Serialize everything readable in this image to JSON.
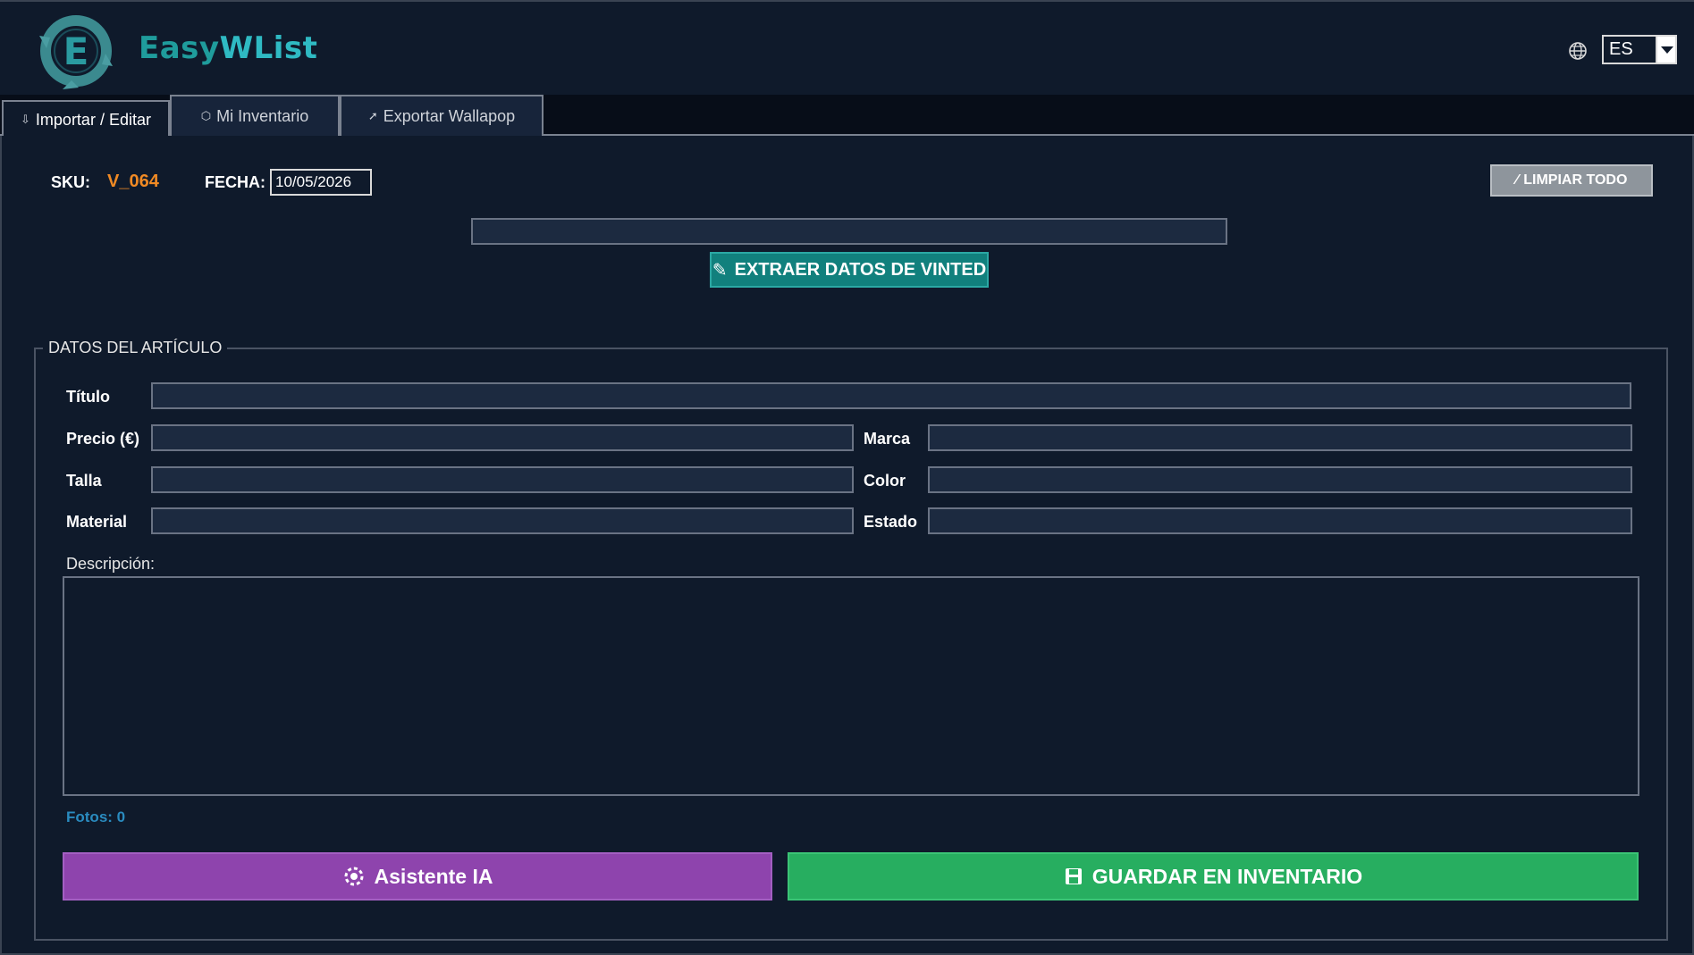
{
  "app": {
    "name_part1": "Easy",
    "name_part2": "WList",
    "logo_icon": "recycle-e-logo-icon",
    "brand_colors": {
      "teal": "#1f9c9c",
      "teal_light": "#2fbac3",
      "background": "#0f1a2b"
    }
  },
  "language": {
    "icon": "globe-icon",
    "selected": "ES"
  },
  "tabs": [
    {
      "label": "Importar / Editar",
      "icon": "import-icon",
      "active": true
    },
    {
      "label": "Mi Inventario",
      "icon": "box-icon",
      "active": false
    },
    {
      "label": "Exportar Wallapop",
      "icon": "rocket-icon",
      "active": false
    }
  ],
  "top": {
    "sku_label": "SKU:",
    "sku_value": "V_064",
    "date_label": "FECHA:",
    "date_value": "10/05/2026",
    "clear_label": "LIMPIAR TODO",
    "url_value": "",
    "extract_label": "EXTRAER DATOS DE VINTED"
  },
  "item": {
    "group_title": "DATOS DEL ARTÍCULO",
    "fields": {
      "title_label": "Título",
      "price_label": "Precio (€)",
      "brand_label": "Marca",
      "size_label": "Talla",
      "color_label": "Color",
      "material_label": "Material",
      "state_label": "Estado"
    },
    "description_label": "Descripción:",
    "photos_text": "Fotos: 0",
    "ai_label": "Asistente IA",
    "save_label": "GUARDAR EN INVENTARIO"
  },
  "colors": {
    "ai_button": "#8e44ad",
    "save_button": "#27ae60",
    "extract_button": "#11807d",
    "sku_value": "#f08a24"
  }
}
